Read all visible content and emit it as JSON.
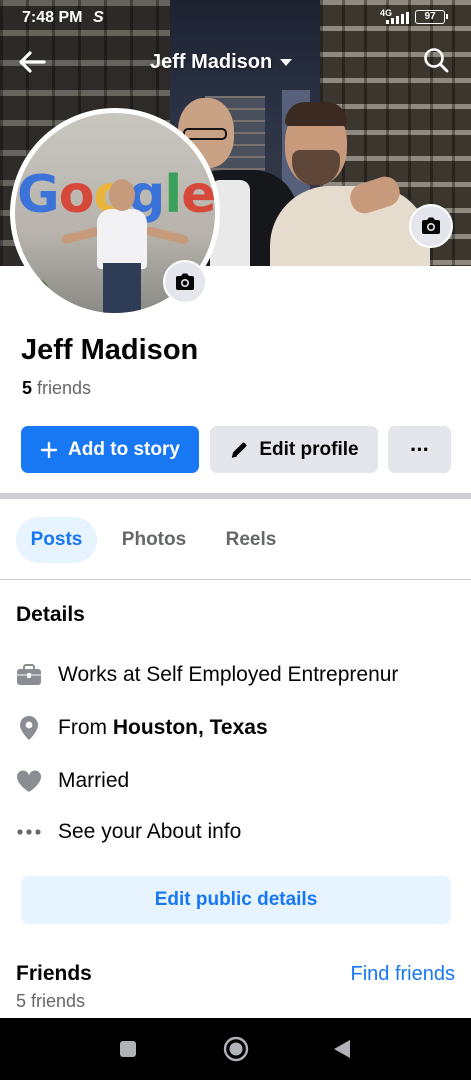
{
  "status_bar": {
    "time": "7:48 PM",
    "app_icon": "S",
    "network": "4G",
    "battery": "97"
  },
  "header": {
    "title": "Jeff Madison",
    "icons": [
      "back-arrow-icon",
      "chevron-down-icon",
      "search-icon"
    ]
  },
  "profile": {
    "name": "Jeff Madison",
    "friend_count": "5",
    "friend_label": " friends",
    "logo_text": [
      "G",
      "o",
      "o",
      "g",
      "l",
      "e"
    ]
  },
  "actions": {
    "add_story": "Add to story",
    "edit_profile": "Edit profile",
    "more": "···"
  },
  "tabs": [
    {
      "label": "Posts",
      "active": true
    },
    {
      "label": "Photos",
      "active": false
    },
    {
      "label": "Reels",
      "active": false
    }
  ],
  "details": {
    "title": "Details",
    "work": "Works at Self Employed Entreprenur",
    "from_prefix": "From ",
    "from_place": "Houston, Texas",
    "relationship": "Married",
    "about": "See your About info",
    "edit_button": "Edit public details"
  },
  "friends_section": {
    "title": "Friends",
    "find_link": "Find friends",
    "count_text": "5 friends"
  },
  "colors": {
    "accent": "#1877f2",
    "accent_light": "#e7f3ff",
    "gray_button": "#e4e6eb",
    "secondary_text": "#65676b",
    "nav_bar": "#000000"
  }
}
